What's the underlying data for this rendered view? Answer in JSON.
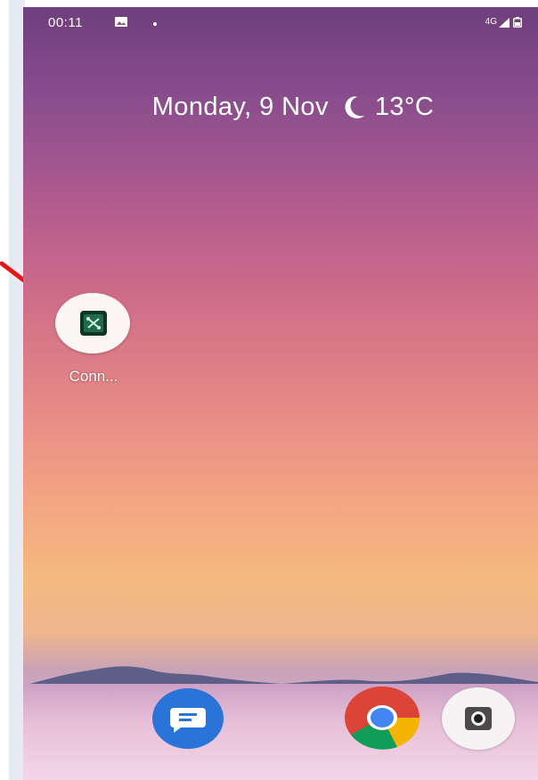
{
  "status_bar": {
    "time": "00:11",
    "network": "4G",
    "icons": [
      "gallery-icon",
      "notification-dot-icon",
      "signal-icon",
      "battery-icon"
    ]
  },
  "date_widget": {
    "date": "Monday, 9 Nov",
    "weather_icon": "moon-icon",
    "temperature": "13°C"
  },
  "home_screen": {
    "apps": [
      {
        "label": "Conn...",
        "icon": "connect-app-icon"
      }
    ]
  },
  "dock": {
    "apps": [
      {
        "icon": "messages-icon"
      },
      {
        "icon": "chrome-icon"
      },
      {
        "icon": "camera-icon"
      }
    ]
  },
  "annotation": {
    "arrow_color": "#e8131b"
  }
}
